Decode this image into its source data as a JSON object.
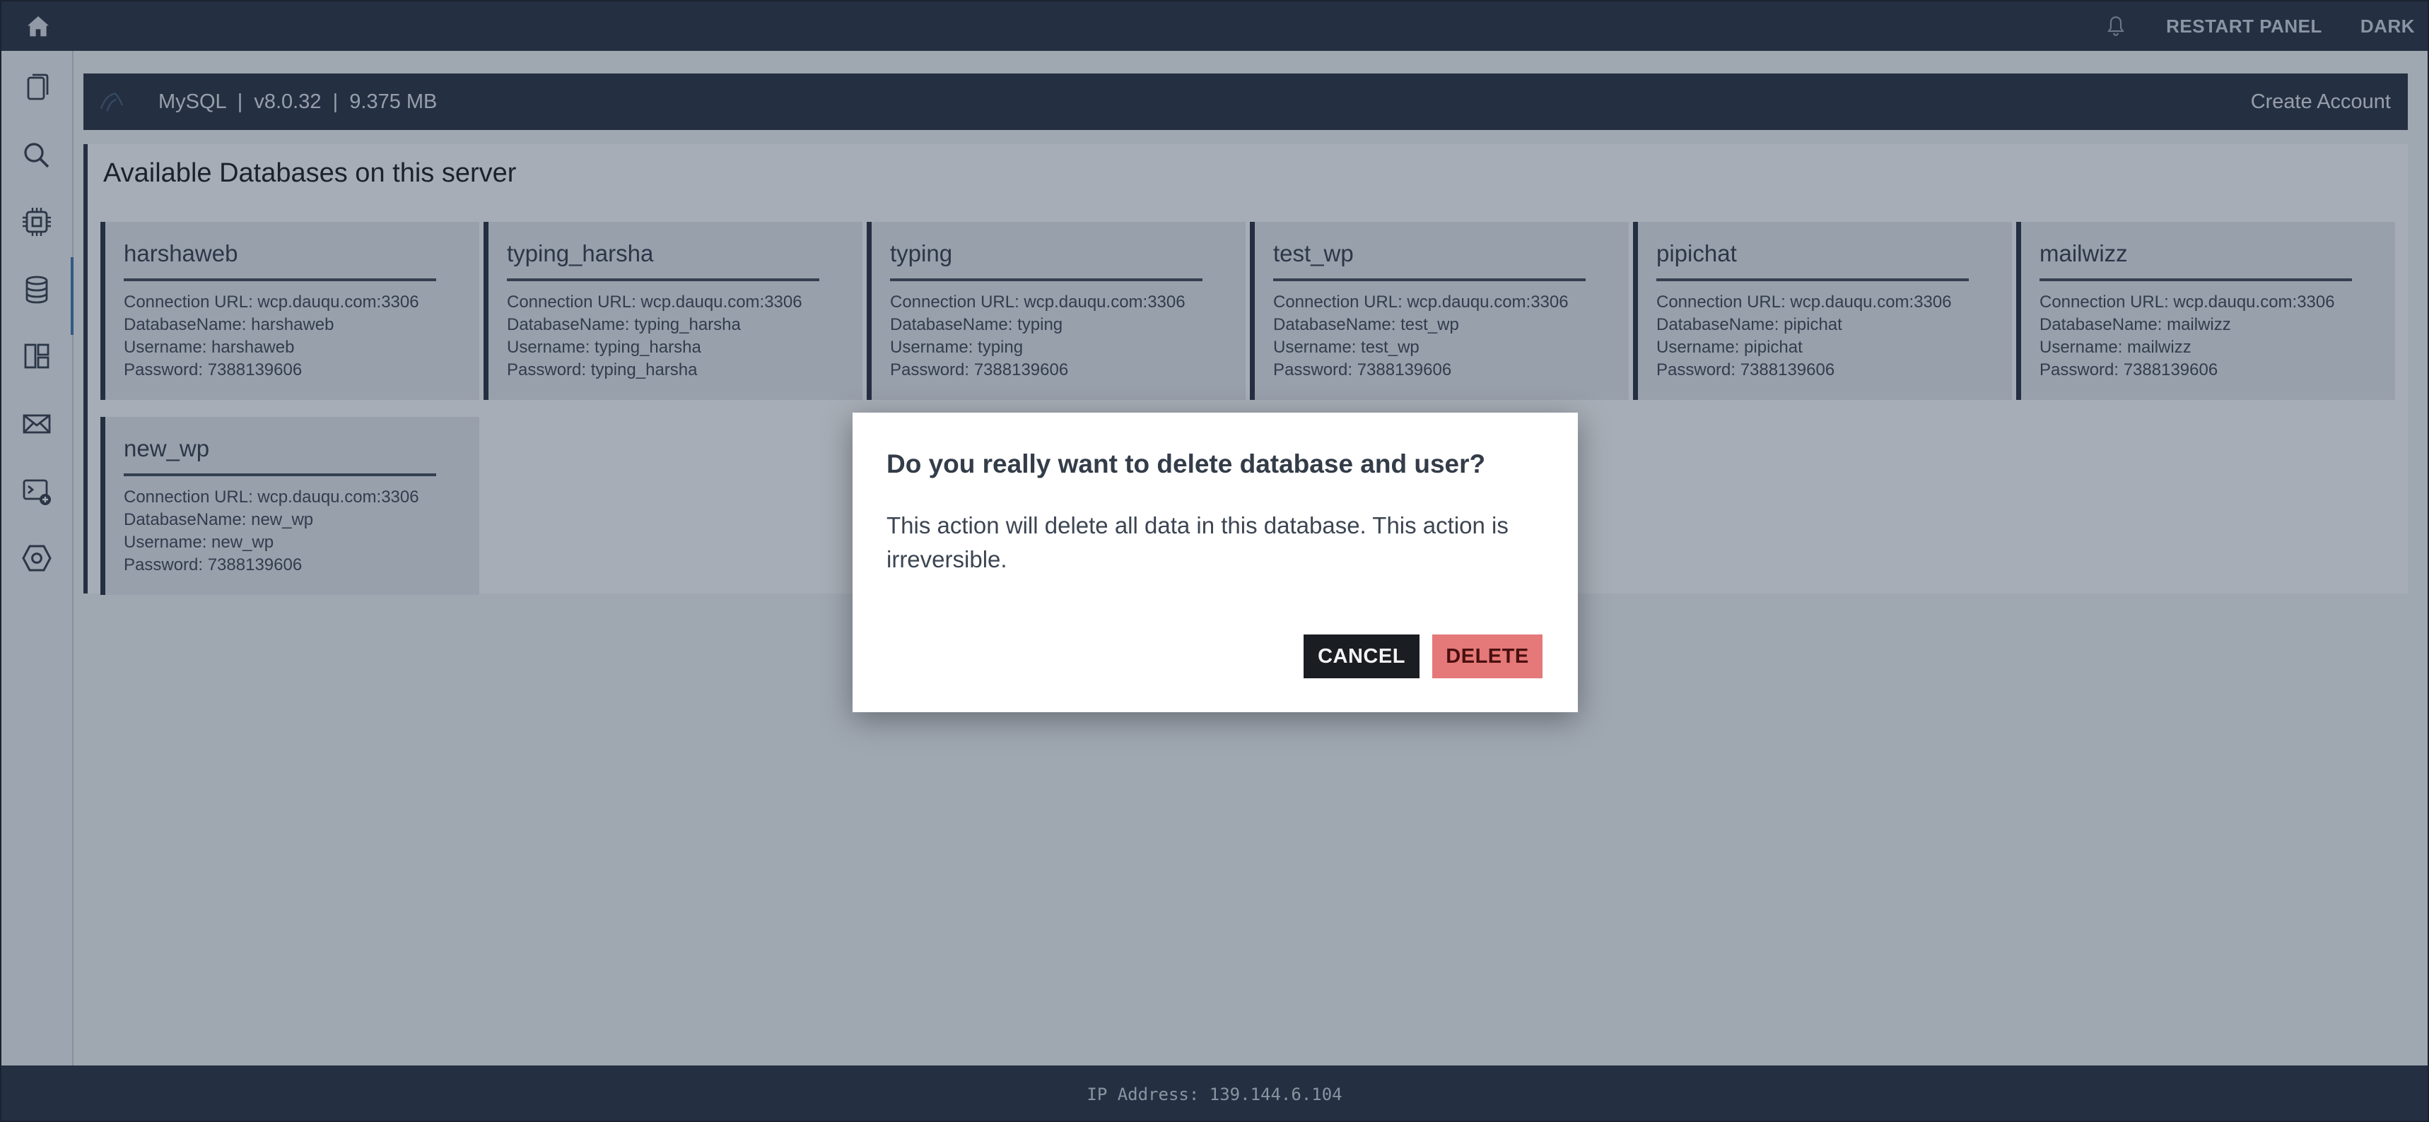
{
  "topbar": {
    "restart_label": "RESTART PANEL",
    "theme_label": "DARK",
    "icons": [
      "home-icon",
      "bell-icon"
    ]
  },
  "sidebar": {
    "items": [
      {
        "icon": "files-icon"
      },
      {
        "icon": "search-icon"
      },
      {
        "icon": "cpu-icon"
      },
      {
        "icon": "database-icon",
        "active": true
      },
      {
        "icon": "dashboard-icon"
      },
      {
        "icon": "mail-icon"
      },
      {
        "icon": "terminal-add-icon"
      },
      {
        "icon": "settings-hexagon-icon"
      }
    ]
  },
  "dbbar": {
    "info": "MySQL  |  v8.0.32  |  9.375 MB",
    "create_account": "Create Account"
  },
  "panel": {
    "title": "Available Databases on this server"
  },
  "databases": [
    {
      "name": "harshaweb",
      "url": "Connection URL: wcp.dauqu.com:3306",
      "dbname": "DatabaseName: harshaweb",
      "username": "Username: harshaweb",
      "password": "Password: 7388139606"
    },
    {
      "name": "typing_harsha",
      "url": "Connection URL: wcp.dauqu.com:3306",
      "dbname": "DatabaseName: typing_harsha",
      "username": "Username: typing_harsha",
      "password": "Password: typing_harsha"
    },
    {
      "name": "typing",
      "url": "Connection URL: wcp.dauqu.com:3306",
      "dbname": "DatabaseName: typing",
      "username": "Username: typing",
      "password": "Password: 7388139606"
    },
    {
      "name": "test_wp",
      "url": "Connection URL: wcp.dauqu.com:3306",
      "dbname": "DatabaseName: test_wp",
      "username": "Username: test_wp",
      "password": "Password: 7388139606"
    },
    {
      "name": "pipichat",
      "url": "Connection URL: wcp.dauqu.com:3306",
      "dbname": "DatabaseName: pipichat",
      "username": "Username: pipichat",
      "password": "Password: 7388139606"
    },
    {
      "name": "mailwizz",
      "url": "Connection URL: wcp.dauqu.com:3306",
      "dbname": "DatabaseName: mailwizz",
      "username": "Username: mailwizz",
      "password": "Password: 7388139606"
    },
    {
      "name": "new_wp",
      "url": "Connection URL: wcp.dauqu.com:3306",
      "dbname": "DatabaseName: new_wp",
      "username": "Username: new_wp",
      "password": "Password: 7388139606"
    }
  ],
  "modal": {
    "title": "Do you really want to delete database and user?",
    "body": "This action will delete all data in this database. This action is irreversible.",
    "cancel_label": "CANCEL",
    "delete_label": "DELETE"
  },
  "footer": {
    "ip": "IP Address: 139.144.6.104"
  },
  "colors": {
    "topbar_bg": "#1e2736",
    "delete_button": "#e57878",
    "cancel_button": "#1a1d22"
  }
}
